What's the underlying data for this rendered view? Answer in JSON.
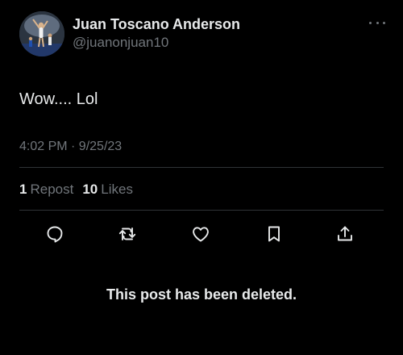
{
  "author": {
    "display_name": "Juan Toscano Anderson",
    "handle": "@juanonjuan10"
  },
  "post": {
    "text": "Wow.... Lol",
    "timestamp": "4:02 PM · 9/25/23"
  },
  "stats": {
    "reposts_count": "1",
    "reposts_label": "Repost",
    "likes_count": "10",
    "likes_label": "Likes"
  },
  "actions": [
    {
      "icon": "reply-icon"
    },
    {
      "icon": "repost-icon"
    },
    {
      "icon": "like-icon"
    },
    {
      "icon": "bookmark-icon"
    },
    {
      "icon": "share-icon"
    }
  ],
  "notice": "This post has been deleted.",
  "colors": {
    "background": "#000000",
    "primary_text": "#e7e9ea",
    "secondary_text": "#71767b",
    "divider": "#2f3336"
  }
}
